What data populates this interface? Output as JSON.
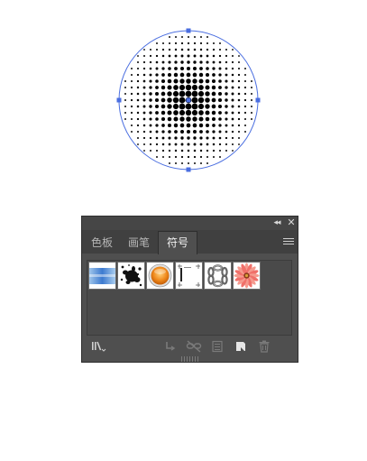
{
  "canvas": {
    "object_name": "halftone-circle",
    "selection_color": "#4a6ee0",
    "dot_color": "#000000"
  },
  "panel": {
    "collapse_label": "◂◂",
    "close_label": "✕",
    "tabs": [
      {
        "label": "色板",
        "active": false
      },
      {
        "label": "画笔",
        "active": false
      },
      {
        "label": "符号",
        "active": true
      }
    ],
    "symbols": [
      {
        "icon": "blue-banner-symbol"
      },
      {
        "icon": "ink-splat-symbol"
      },
      {
        "icon": "orange-button-symbol"
      },
      {
        "icon": "crop-marks-symbol"
      },
      {
        "icon": "chain-ring-symbol"
      },
      {
        "icon": "pink-flower-symbol"
      }
    ],
    "footer_icons": [
      "symbol-libraries-menu-icon",
      "place-symbol-instance-icon",
      "break-link-icon",
      "symbol-options-icon",
      "new-symbol-icon",
      "delete-symbol-icon"
    ],
    "colors": {
      "panel_bg": "#4f4f4f",
      "tab_bar_bg": "#404040",
      "orange": "#f08a1c",
      "flower": "#f0706a"
    }
  }
}
